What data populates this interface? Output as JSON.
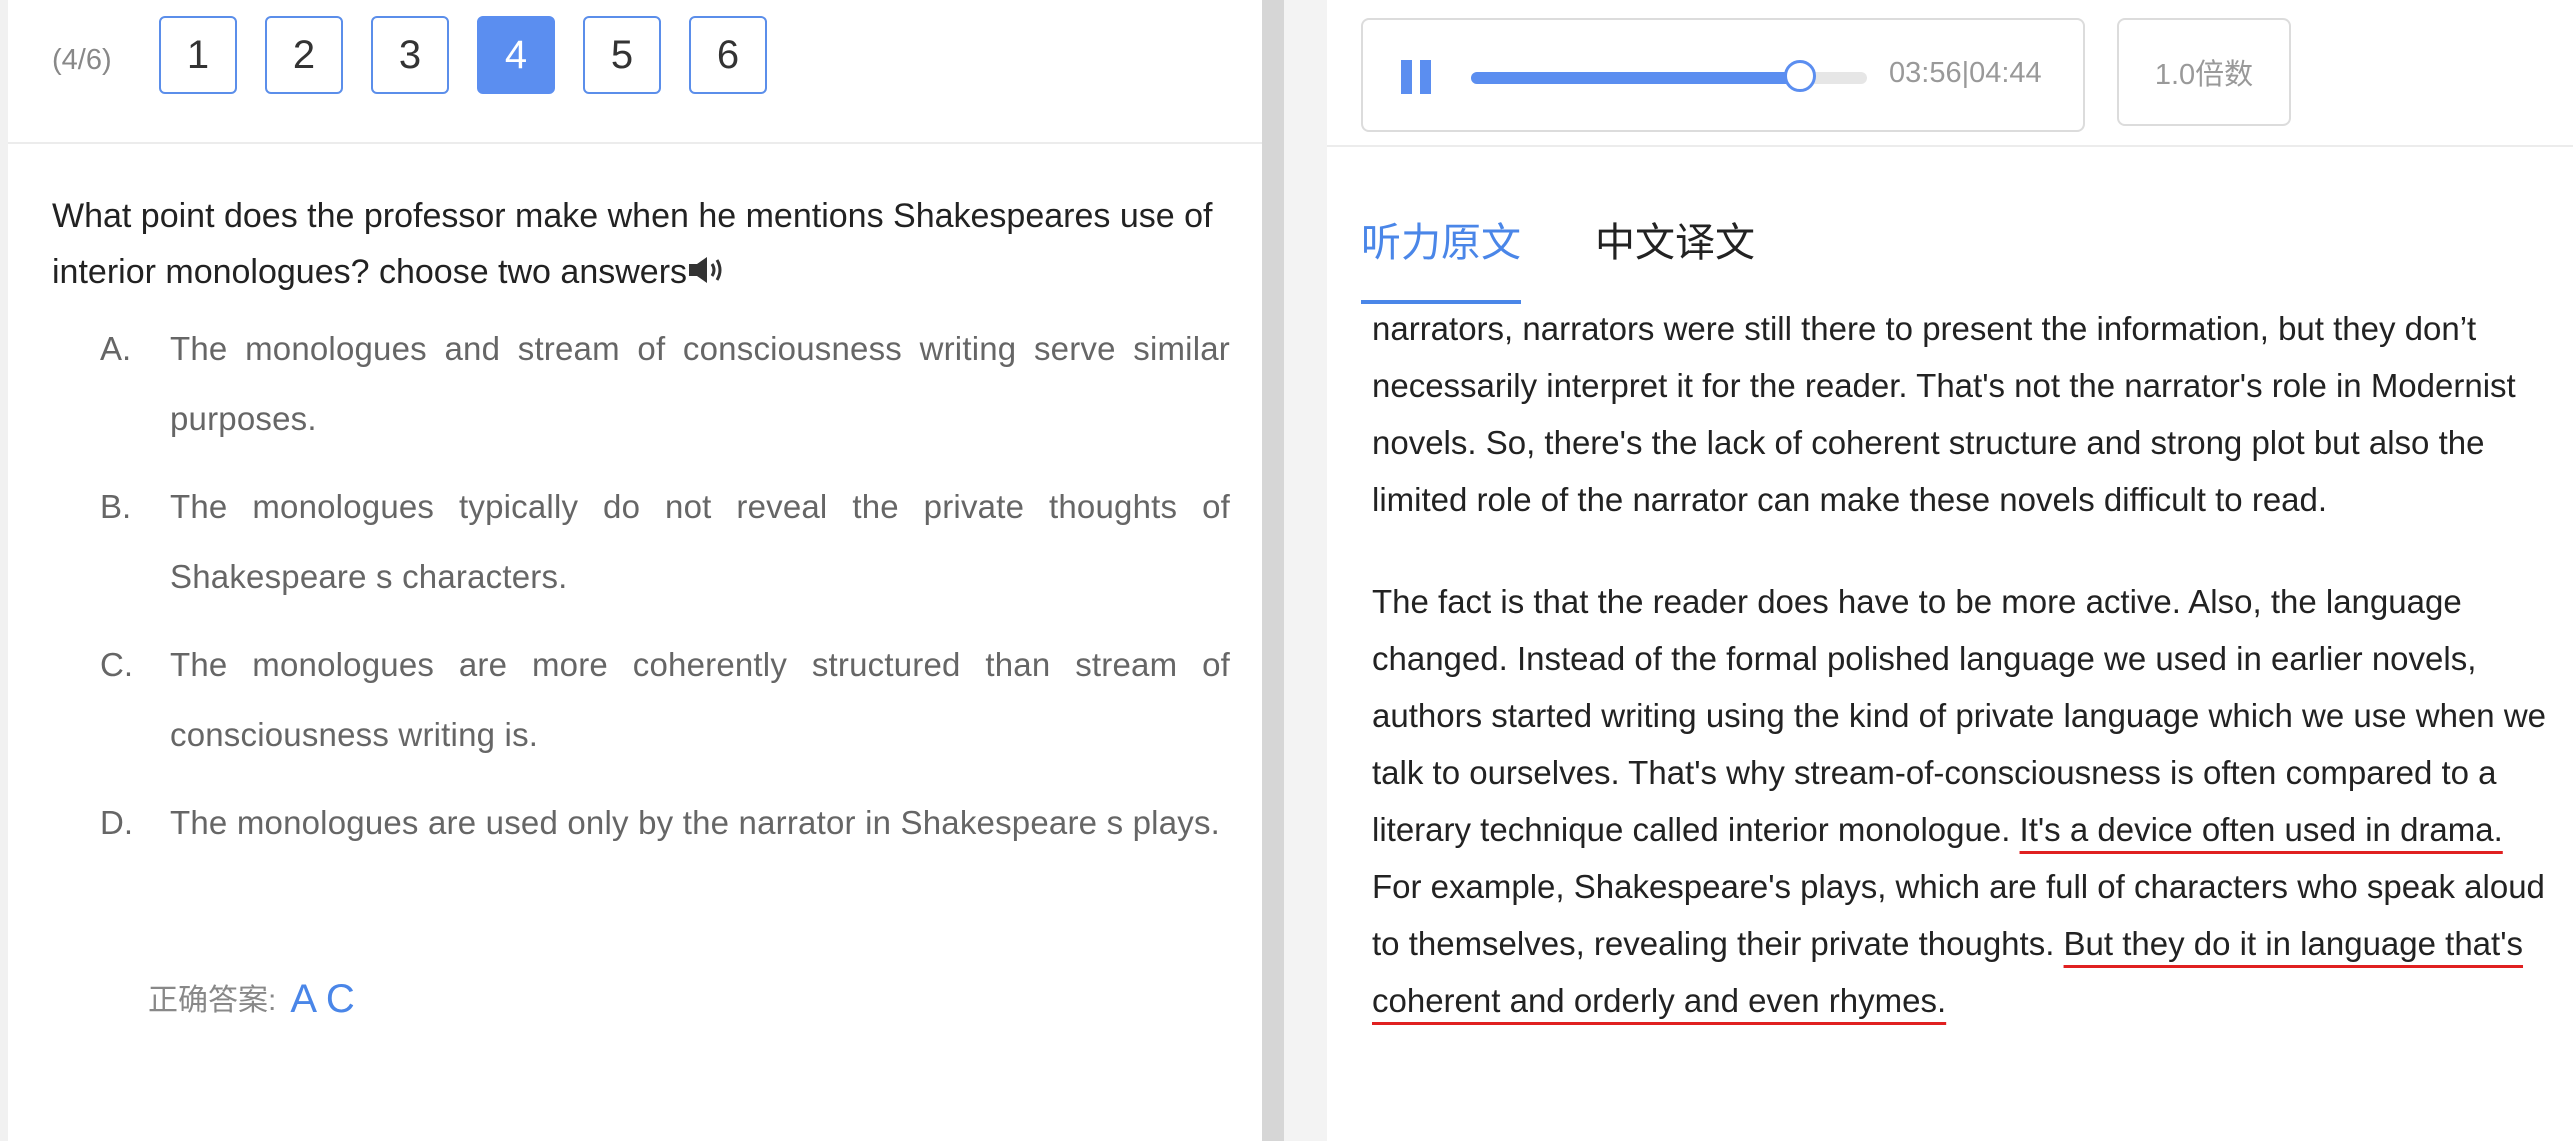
{
  "question_nav": {
    "progress": "(4/6)",
    "buttons": [
      "1",
      "2",
      "3",
      "4",
      "5",
      "6"
    ],
    "active": "4"
  },
  "question": {
    "text": "What point does the professor make when he mentions Shakespeares use of interior monologues? choose two answers",
    "speaker_icon": "speaker-icon",
    "options": [
      {
        "letter": "A.",
        "text": "The monologues and stream of consciousness writing serve similar purposes."
      },
      {
        "letter": "B.",
        "text": "The monologues typically do not reveal the private thoughts of Shakespeare s characters."
      },
      {
        "letter": "C.",
        "text": "The monologues are more coherently structured than stream of consciousness writing is."
      },
      {
        "letter": "D.",
        "text": "The monologues are used only by the narrator in Shakespeare s plays."
      }
    ],
    "answer_label": "正确答案:",
    "answer_value": "A C"
  },
  "player": {
    "time_current": "03:56",
    "time_total": "04:44",
    "time_display": "03:56|04:44",
    "progress_fraction": 0.831,
    "speed_label": "1.0倍数",
    "accent_color": "#5b8ef0"
  },
  "tabs": {
    "original": "听力原文",
    "translation": "中文译文",
    "active": "original"
  },
  "transcript": {
    "p1": "narrators, narrators were still there to present the information, but they don’t necessarily interpret it for the reader. That's not the narrator's role in Modernist novels. So, there's the lack of coherent structure and strong plot but also the limited role of the narrator can make these novels difficult to read.",
    "p2_a": "The fact is that the reader does have to be more active. Also, the language changed. Instead of the formal polished language we used in earlier novels, authors started writing using the kind of private language which we use when we talk to ourselves. That's why stream-of-consciousness is often compared to a literary technique called interior monologue. ",
    "p2_hl1": "It's a device often used in drama.",
    "p2_b": " For example, Shakespeare's plays, which are full of characters who speak aloud to themselves, revealing their private thoughts. ",
    "p2_hl2": "But they do it in language that's coherent and orderly and even rhymes.",
    "underline_color": "#e02020"
  }
}
